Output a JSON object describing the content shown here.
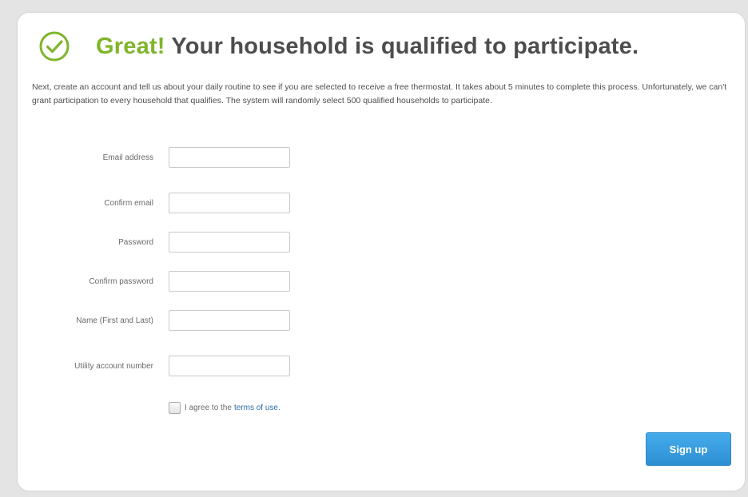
{
  "header": {
    "title_accent": "Great!",
    "title_rest": "Your household is qualified to participate.",
    "accent_color": "#7fb52b",
    "icon": "checkmark-circle-icon"
  },
  "intro": {
    "text": "Next, create an account and tell us about your daily routine to see if you are selected to receive a free thermostat. It takes about 5 minutes to complete this process. Unfortunately, we can't grant participation to every household that qualifies. The system will randomly select 500 qualified households to participate."
  },
  "form": {
    "fields": [
      {
        "label": "Email address",
        "value": "",
        "placeholder": ""
      },
      {
        "label": "Confirm email",
        "value": "",
        "placeholder": ""
      },
      {
        "label": "Password",
        "value": "",
        "placeholder": ""
      },
      {
        "label": "Confirm password",
        "value": "",
        "placeholder": ""
      },
      {
        "label": "Name (First and Last)",
        "value": "",
        "placeholder": ""
      },
      {
        "label": "Utility account number",
        "value": "",
        "placeholder": ""
      }
    ],
    "agree_text": "I agree to the",
    "terms_link": "terms of use.",
    "signup_label": "Sign up",
    "button_color": "#2d8fd2"
  }
}
